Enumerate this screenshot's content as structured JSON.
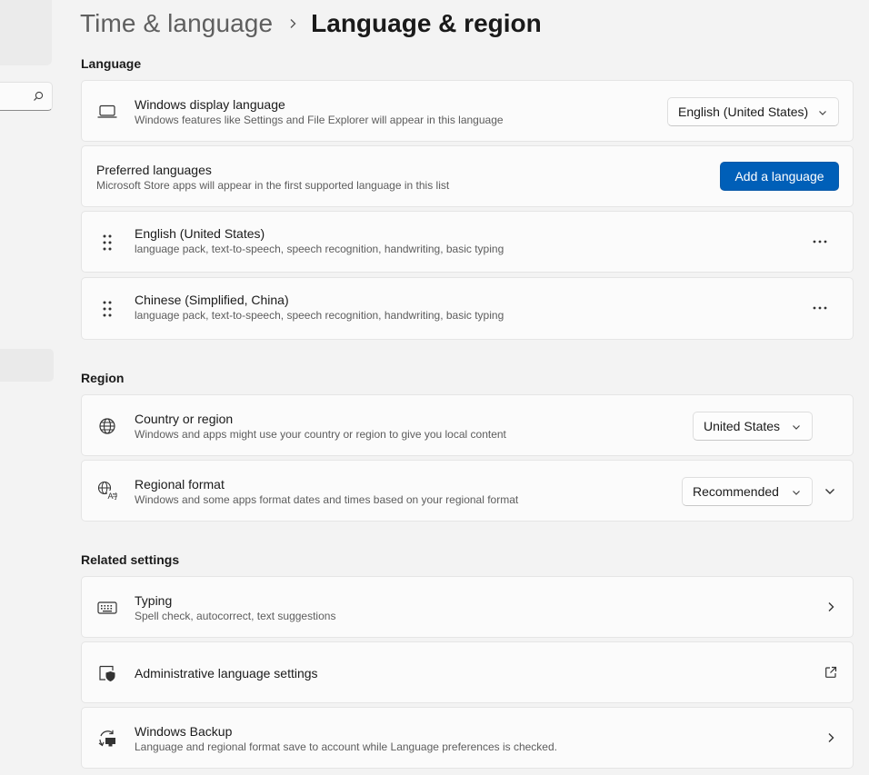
{
  "breadcrumb": {
    "parent": "Time & language",
    "current": "Language & region"
  },
  "sections": {
    "language": "Language",
    "region": "Region",
    "related": "Related settings"
  },
  "language": {
    "display": {
      "title": "Windows display language",
      "desc": "Windows features like Settings and File Explorer will appear in this language",
      "value": "English (United States)",
      "icon": "laptop-icon"
    },
    "preferred": {
      "title": "Preferred languages",
      "desc": "Microsoft Store apps will appear in the first supported language in this list",
      "button": "Add a language"
    },
    "items": [
      {
        "name": "English (United States)",
        "features": "language pack, text-to-speech, speech recognition, handwriting, basic typing"
      },
      {
        "name": "Chinese (Simplified, China)",
        "features": "language pack, text-to-speech, speech recognition, handwriting, basic typing"
      }
    ]
  },
  "region": {
    "country": {
      "title": "Country or region",
      "desc": "Windows and apps might use your country or region to give you local content",
      "value": "United States",
      "icon": "globe-icon"
    },
    "format": {
      "title": "Regional format",
      "desc": "Windows and some apps format dates and times based on your regional format",
      "value": "Recommended",
      "icon": "regional-format-icon"
    }
  },
  "related": {
    "typing": {
      "title": "Typing",
      "desc": "Spell check, autocorrect, text suggestions",
      "icon": "keyboard-icon"
    },
    "admin": {
      "title": "Administrative language settings",
      "icon": "admin-shield-icon"
    },
    "backup": {
      "title": "Windows Backup",
      "desc": "Language and regional format save to account while Language preferences is checked.",
      "icon": "backup-icon"
    }
  },
  "colors": {
    "accent": "#005fb8",
    "background": "#f3f3f3",
    "card": "#fbfbfb"
  }
}
